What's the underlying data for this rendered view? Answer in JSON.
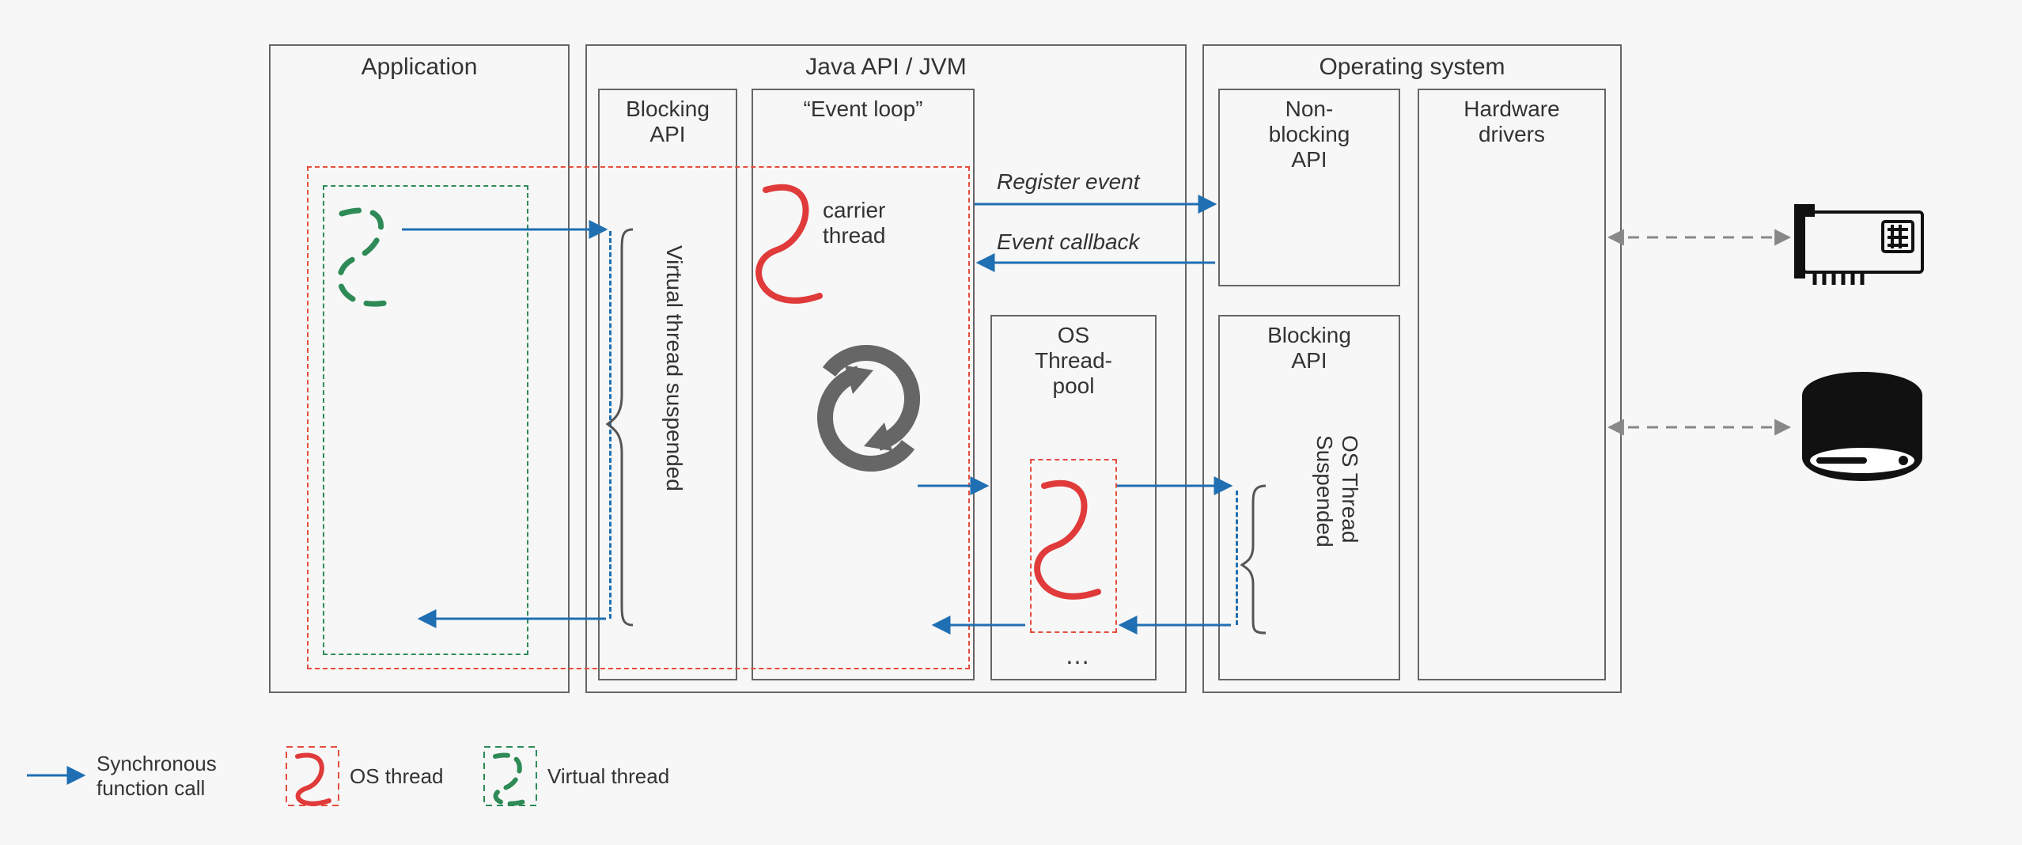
{
  "columns": {
    "application": {
      "title": "Application"
    },
    "jvm": {
      "title": "Java API / JVM",
      "blocking_api": {
        "title": "Blocking\nAPI",
        "suspended_label": "Virtual thread suspended"
      },
      "event_loop": {
        "title": "“Event loop”",
        "carrier_label": "carrier\nthread"
      },
      "threadpool": {
        "title": "OS\nThread-\npool",
        "ellipsis": "…"
      }
    },
    "os": {
      "title": "Operating system",
      "nonblocking": {
        "title": "Non-\nblocking\nAPI"
      },
      "blocking": {
        "title": "Blocking\nAPI",
        "suspended_label": "OS Thread\nSuspended"
      },
      "hardware_drivers": {
        "title": "Hardware\ndrivers"
      }
    }
  },
  "arrows": {
    "register_event": "Register event",
    "event_callback": "Event callback"
  },
  "legend": {
    "sync": "Synchronous\nfunction call",
    "os_thread": "OS thread",
    "virtual_thread": "Virtual thread"
  }
}
